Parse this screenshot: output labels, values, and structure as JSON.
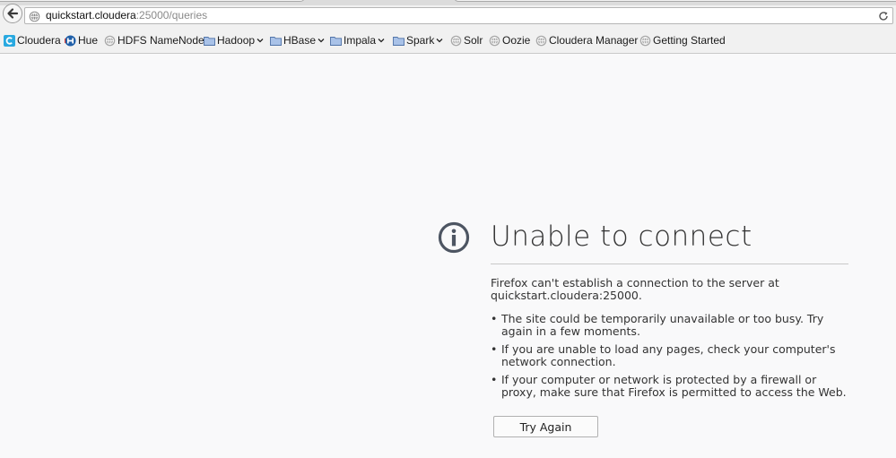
{
  "browser": {
    "url_host": "quickstart.cloudera",
    "url_rest": ":25000/queries",
    "icons": {
      "back": "back-arrow-icon",
      "info": "page-info-icon",
      "reload": "reload-icon"
    }
  },
  "bookmarks": [
    {
      "label": "Cloudera",
      "icon": "cloudera-icon"
    },
    {
      "label": "Hue",
      "icon": "hue-icon"
    },
    {
      "label": "HDFS NameNode",
      "icon": "globe-icon"
    },
    {
      "label": "Hadoop",
      "icon": "folder-icon",
      "dropdown": true
    },
    {
      "label": "HBase",
      "icon": "folder-icon",
      "dropdown": true
    },
    {
      "label": "Impala",
      "icon": "folder-icon",
      "dropdown": true
    },
    {
      "label": "Spark",
      "icon": "folder-icon",
      "dropdown": true
    },
    {
      "label": "Solr",
      "icon": "globe-icon"
    },
    {
      "label": "Oozie",
      "icon": "globe-icon"
    },
    {
      "label": "Cloudera Manager",
      "icon": "globe-icon"
    },
    {
      "label": "Getting Started",
      "icon": "globe-icon"
    }
  ],
  "error": {
    "icon": "info-circle-icon",
    "title": "Unable to connect",
    "description": "Firefox can't establish a connection to the server at quickstart.cloudera:25000.",
    "bullets": [
      "The site could be temporarily unavailable or too busy. Try again in a few moments.",
      "If you are unable to load any pages, check your computer's network connection.",
      "If your computer or network is protected by a firewall or proxy, make sure that Firefox is permitted to access the Web."
    ],
    "button_label": "Try Again"
  },
  "colors": {
    "page_bg": "#f9f9fa",
    "cloudera_blue": "#29a9e0",
    "folder_blue": "#6b8fc7"
  }
}
